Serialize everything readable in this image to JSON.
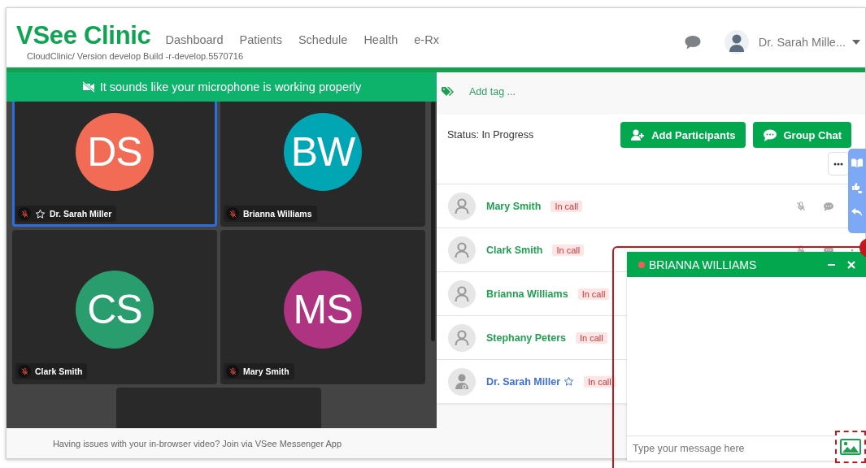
{
  "header": {
    "logo": "VSee Clinic",
    "build": "CloudClinic/ Version develop Build -r-develop.5570716",
    "nav": [
      {
        "label": "Dashboard"
      },
      {
        "label": "Patients"
      },
      {
        "label": "Schedule"
      },
      {
        "label": "Health"
      },
      {
        "label": "e-Rx"
      }
    ],
    "user": "Dr. Sarah Mille..."
  },
  "banner": {
    "text": "It sounds like your microphone is working properly"
  },
  "video_tiles": [
    {
      "initials": "DS",
      "name": "Dr. Sarah Miller",
      "color": "#f26b55",
      "selected": true,
      "starred": true
    },
    {
      "initials": "BW",
      "name": "Brianna Williams",
      "color": "#00a6b4",
      "selected": false,
      "starred": false
    },
    {
      "initials": "CS",
      "name": "Clark Smith",
      "color": "#2a9d6f",
      "selected": false,
      "starred": false
    },
    {
      "initials": "MS",
      "name": "Mary Smith",
      "color": "#ae3380",
      "selected": false,
      "starred": false
    }
  ],
  "video_footer": "Having issues with your in-browser video? Join via VSee Messenger App",
  "tag_bar": {
    "link": "Add tag ..."
  },
  "status": "Status: In Progress",
  "buttons": [
    {
      "label": "Add Participants",
      "kind": "add"
    },
    {
      "label": "Group Chat",
      "kind": "chat"
    }
  ],
  "participants": [
    {
      "name": "Mary Smith",
      "badge": "In call",
      "kind": "patient",
      "starred": false,
      "actions": true
    },
    {
      "name": "Clark Smith",
      "badge": "In call",
      "kind": "patient",
      "starred": false,
      "actions": true
    },
    {
      "name": "Brianna Williams",
      "badge": "In call",
      "kind": "patient",
      "starred": false,
      "actions": false
    },
    {
      "name": "Stephany Peters",
      "badge": "In call",
      "kind": "patient",
      "starred": false,
      "actions": false
    },
    {
      "name": "Dr. Sarah Miller",
      "badge": "In call",
      "kind": "provider",
      "starred": true,
      "actions": false
    }
  ],
  "chat": {
    "title": "BRIANNA WILLIAMS",
    "placeholder": "Type your message here"
  }
}
